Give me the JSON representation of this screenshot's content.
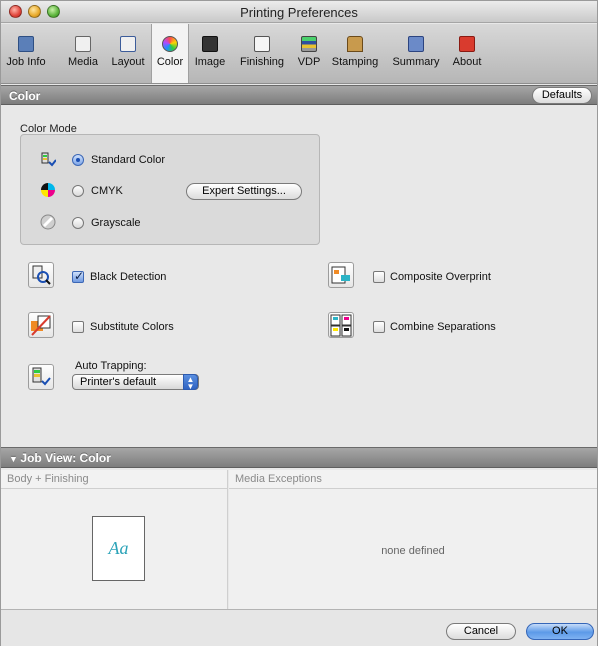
{
  "window": {
    "title": "Printing Preferences"
  },
  "toolbar": {
    "items": [
      {
        "label": "Job Info",
        "icon": "job-info-icon"
      },
      {
        "label": "Media",
        "icon": "media-icon"
      },
      {
        "label": "Layout",
        "icon": "layout-icon"
      },
      {
        "label": "Color",
        "icon": "color-wheel-icon",
        "active": true
      },
      {
        "label": "Image",
        "icon": "image-icon"
      },
      {
        "label": "Finishing",
        "icon": "finishing-icon"
      },
      {
        "label": "VDP",
        "icon": "vdp-icon"
      },
      {
        "label": "Stamping",
        "icon": "stamp-icon"
      },
      {
        "label": "Summary",
        "icon": "summary-icon"
      },
      {
        "label": "About",
        "icon": "about-icon"
      }
    ]
  },
  "color_section": {
    "title": "Color",
    "defaults_button": "Defaults",
    "color_mode": {
      "label": "Color Mode",
      "options": [
        {
          "label": "Standard Color",
          "selected": true
        },
        {
          "label": "CMYK",
          "selected": false
        },
        {
          "label": "Grayscale",
          "selected": false
        }
      ],
      "expert_button": "Expert Settings..."
    },
    "black_detection": {
      "label": "Black Detection",
      "checked": true
    },
    "substitute_colors": {
      "label": "Substitute Colors",
      "checked": false
    },
    "composite_overprint": {
      "label": "Composite Overprint",
      "checked": false
    },
    "combine_separations": {
      "label": "Combine Separations",
      "checked": false
    },
    "auto_trapping": {
      "label": "Auto Trapping:",
      "value": "Printer's default"
    }
  },
  "job_view": {
    "title": "Job View: Color",
    "left_header": "Body + Finishing",
    "right_header": "Media Exceptions",
    "thumbnail_text": "Aa",
    "right_empty": "none defined"
  },
  "footer": {
    "cancel": "Cancel",
    "ok": "OK"
  },
  "colors": {
    "accent": "#2f63c2",
    "header_bar": "#8e8e8e"
  }
}
